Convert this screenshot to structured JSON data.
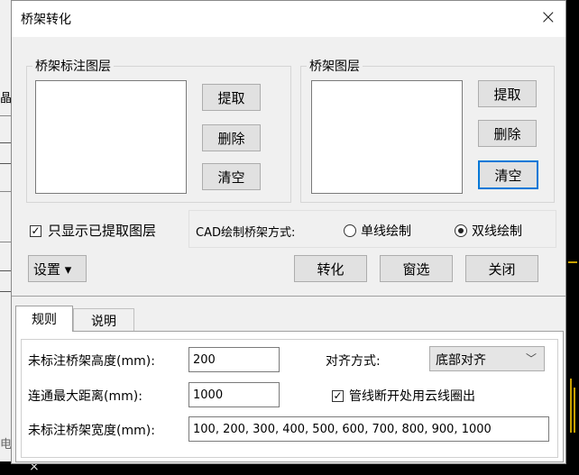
{
  "dialog": {
    "title": "桥架转化",
    "close_glyph": "×"
  },
  "layer_group": {
    "legend": "桥架标注图层",
    "extract": "提取",
    "delete": "删除",
    "clear": "清空"
  },
  "tray_group": {
    "legend": "桥架图层",
    "extract": "提取",
    "delete": "删除",
    "clear": "清空"
  },
  "options": {
    "only_extracted_label": "只显示已提取图层",
    "only_extracted_checked": true,
    "cad_mode_label": "CAD绘制桥架方式:",
    "single_line_label": "单线绘制",
    "double_line_label": "双线绘制",
    "selected_mode": "double"
  },
  "actions": {
    "settings": "设置 ▾",
    "convert": "转化",
    "window_select": "窗选",
    "close": "关闭"
  },
  "tabs": [
    {
      "label": "规则"
    },
    {
      "label": "说明"
    }
  ],
  "rules": {
    "height_label": "未标注桥架高度(mm):",
    "height_value": "200",
    "align_label": "对齐方式:",
    "align_value": "底部对齐",
    "distance_label": "连通最大距离(mm):",
    "distance_value": "1000",
    "cloud_label": "管线断开处用云线圈出",
    "cloud_checked": true,
    "width_label": "未标注桥架宽度(mm):",
    "width_value": "100, 200, 300, 400, 500, 600, 700, 800, 900, 1000"
  },
  "background": {
    "left_fragment": "晶",
    "left_fragment2": "电",
    "bottom_glyph": "×"
  }
}
